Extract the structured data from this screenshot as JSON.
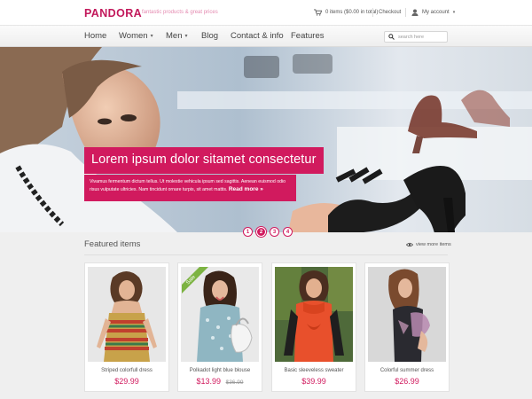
{
  "brand": {
    "logo": "PANDORA",
    "tagline": "fantastic products & great prices"
  },
  "topbar": {
    "cart_text": "0 items ($0.00 in total)",
    "checkout": "Checkout",
    "account": "My account",
    "icons": [
      "cart-icon",
      "user-icon",
      "chevron-down-icon"
    ]
  },
  "nav": {
    "items": [
      {
        "label": "Home"
      },
      {
        "label": "Women",
        "caret": "▾"
      },
      {
        "label": "Men",
        "caret": "▾"
      },
      {
        "label": "Blog"
      },
      {
        "label": "Contact & info"
      },
      {
        "label": "Features"
      }
    ],
    "search_placeholder": "search here"
  },
  "hero": {
    "title": "Lorem ipsum dolor sitamet consectetur",
    "body": "Vivamus fermentum dictum tellus. Ut molestie vehicula ipsum sed sagittis. Aenean euismod odio risus vulputate ultricies. Nam tincidunt ornare turpis, sit amet mattis.",
    "read_more": "Read more »",
    "slides": [
      "1",
      "2",
      "3",
      "4"
    ],
    "active_slide": 2
  },
  "featured": {
    "title": "Featured items",
    "view_more": "view more items",
    "products": [
      {
        "name": "Striped colorfull dress",
        "price": "$29.99"
      },
      {
        "name": "Polkadot light blue blouse",
        "price": "$13.99",
        "old_price": "$36.99",
        "badge": "Sale"
      },
      {
        "name": "Basic sleeveless sweater",
        "price": "$39.99"
      },
      {
        "name": "Colorful summer dress",
        "price": "$26.99"
      }
    ]
  },
  "colors": {
    "accent": "#d11a5e",
    "logo": "#c2185b"
  }
}
